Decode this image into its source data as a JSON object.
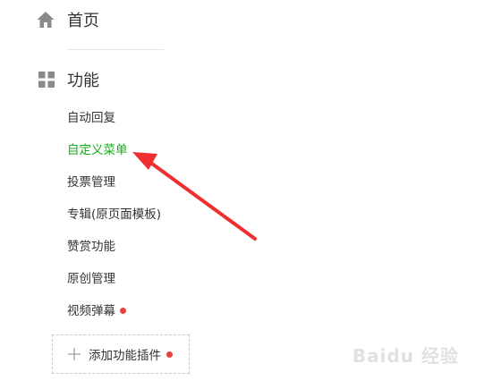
{
  "nav": {
    "home": {
      "label": "首页",
      "icon": "home-icon"
    },
    "features": {
      "label": "功能",
      "icon": "grid-icon",
      "items": [
        {
          "label": "自动回复",
          "active": false,
          "badge": false
        },
        {
          "label": "自定义菜单",
          "active": true,
          "badge": false
        },
        {
          "label": "投票管理",
          "active": false,
          "badge": false
        },
        {
          "label": "专辑(原页面模板)",
          "active": false,
          "badge": false
        },
        {
          "label": "赞赏功能",
          "active": false,
          "badge": false
        },
        {
          "label": "原创管理",
          "active": false,
          "badge": false
        },
        {
          "label": "视频弹幕",
          "active": false,
          "badge": true
        }
      ]
    },
    "add_plugin": {
      "label": "添加功能插件",
      "icon": "plus-icon",
      "badge": true
    }
  },
  "colors": {
    "active": "#1aad19",
    "text": "#333333",
    "icon": "#8a8a8a",
    "badge": "#e64340",
    "annotation_arrow": "#f03030"
  },
  "watermark": {
    "text": "Baidu 经验"
  }
}
